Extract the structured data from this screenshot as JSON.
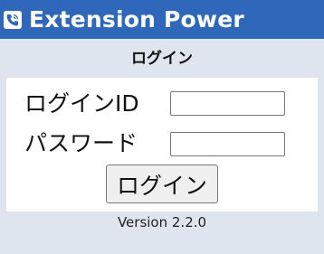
{
  "header": {
    "title": "Extension Power",
    "logo_icon": "phone-icon",
    "background_color": "#2f68ba"
  },
  "page": {
    "title": "ログイン"
  },
  "form": {
    "login_id_label": "ログインID",
    "login_id_value": "",
    "password_label": "パスワード",
    "password_value": "",
    "submit_label": "ログイン"
  },
  "footer": {
    "version": "Version 2.2.0"
  }
}
